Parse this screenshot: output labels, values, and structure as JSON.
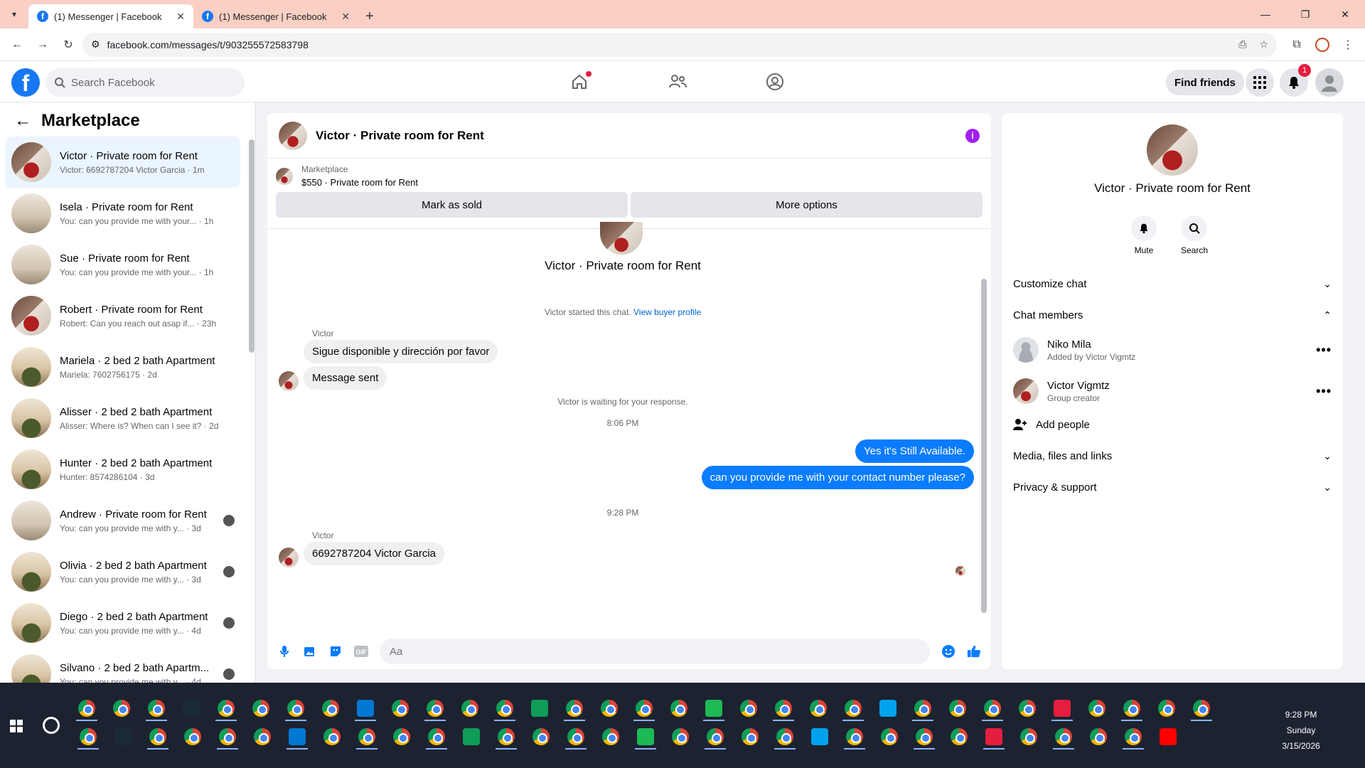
{
  "browser": {
    "tabs": [
      {
        "title": "(1) Messenger | Facebook",
        "active": true
      },
      {
        "title": "(1) Messenger | Facebook",
        "active": false
      }
    ],
    "url": "facebook.com/messages/t/903255572583798",
    "new_tab": "+"
  },
  "fb": {
    "search_placeholder": "Search Facebook",
    "find_friends": "Find friends",
    "notification_count": "1"
  },
  "left": {
    "title": "Marketplace",
    "conversations": [
      {
        "name": "Victor · Private room for Rent",
        "sub": "Victor: 6692787204 Victor Garcia · 1m",
        "avatar": "room",
        "active": true
      },
      {
        "name": "Isela · Private room for Rent",
        "sub": "You: can you provide me with your... · 1h",
        "avatar": "gray"
      },
      {
        "name": "Sue · Private room for Rent",
        "sub": "You: can you provide me with your... · 1h",
        "avatar": "gray"
      },
      {
        "name": "Robert · Private room for Rent",
        "sub": "Robert: Can you reach out asap if... · 23h",
        "avatar": "room"
      },
      {
        "name": "Mariela · 2 bed 2 bath Apartment",
        "sub": "Mariela: 7602756175 · 2d",
        "avatar": "apt"
      },
      {
        "name": "Alisser · 2 bed 2 bath Apartment",
        "sub": "Alisser: Where is? When can I see it? · 2d",
        "avatar": "apt"
      },
      {
        "name": "Hunter · 2 bed 2 bath Apartment",
        "sub": "Hunter: 8574286104 · 3d",
        "avatar": "apt"
      },
      {
        "name": "Andrew · Private room for Rent",
        "sub": "You: can you provide me with y... · 3d",
        "avatar": "gray",
        "seen": true
      },
      {
        "name": "Olivia · 2 bed 2 bath Apartment",
        "sub": "You: can you provide me with y... · 3d",
        "avatar": "apt",
        "seen": true
      },
      {
        "name": "Diego · 2 bed 2 bath Apartment",
        "sub": "You: can you provide me with y... · 4d",
        "avatar": "apt",
        "seen": true
      },
      {
        "name": "Silvano · 2 bed 2 bath Apartm...",
        "sub": "You: can you provide me with y... · 4d",
        "avatar": "apt",
        "seen": true
      }
    ]
  },
  "chat": {
    "title": "Victor · Private room for Rent",
    "marketplace_label": "Marketplace",
    "listing": "$550 · Private room for Rent",
    "mark_sold": "Mark as sold",
    "more_options": "More options",
    "intro_name": "Victor · Private room for Rent",
    "started_note": "Victor started this chat.",
    "buyer_profile_link": "View buyer profile",
    "sender1": "Victor",
    "msg1": "Sigue disponible y dirección por favor",
    "msg2": "Message sent",
    "waiting_note": "Victor is waiting for your response.",
    "time1": "8:06 PM",
    "out1": "Yes it's Still Available.",
    "out2": "can you provide me with your contact number please?",
    "time2": "9:28 PM",
    "sender2": "Victor",
    "msg3": "6692787204 Victor Garcia",
    "composer_placeholder": "Aa"
  },
  "right": {
    "name": "Victor · Private room for Rent",
    "mute": "Mute",
    "search": "Search",
    "customize": "Customize chat",
    "members_header": "Chat members",
    "members": [
      {
        "name": "Niko Mila",
        "sub": "Added by Victor Vigmtz"
      },
      {
        "name": "Victor Vigmtz",
        "sub": "Group creator"
      }
    ],
    "add_people": "Add people",
    "media": "Media, files and links",
    "privacy": "Privacy & support"
  },
  "tray": {
    "time": "9:28 PM",
    "day": "Sunday",
    "date": "3/15/2026"
  },
  "colors": {
    "brand": "#1877f2",
    "outgoing_bubble": "#0a7cff",
    "info_icon": "#a020f0",
    "tab_bar": "#f9d0c3"
  }
}
